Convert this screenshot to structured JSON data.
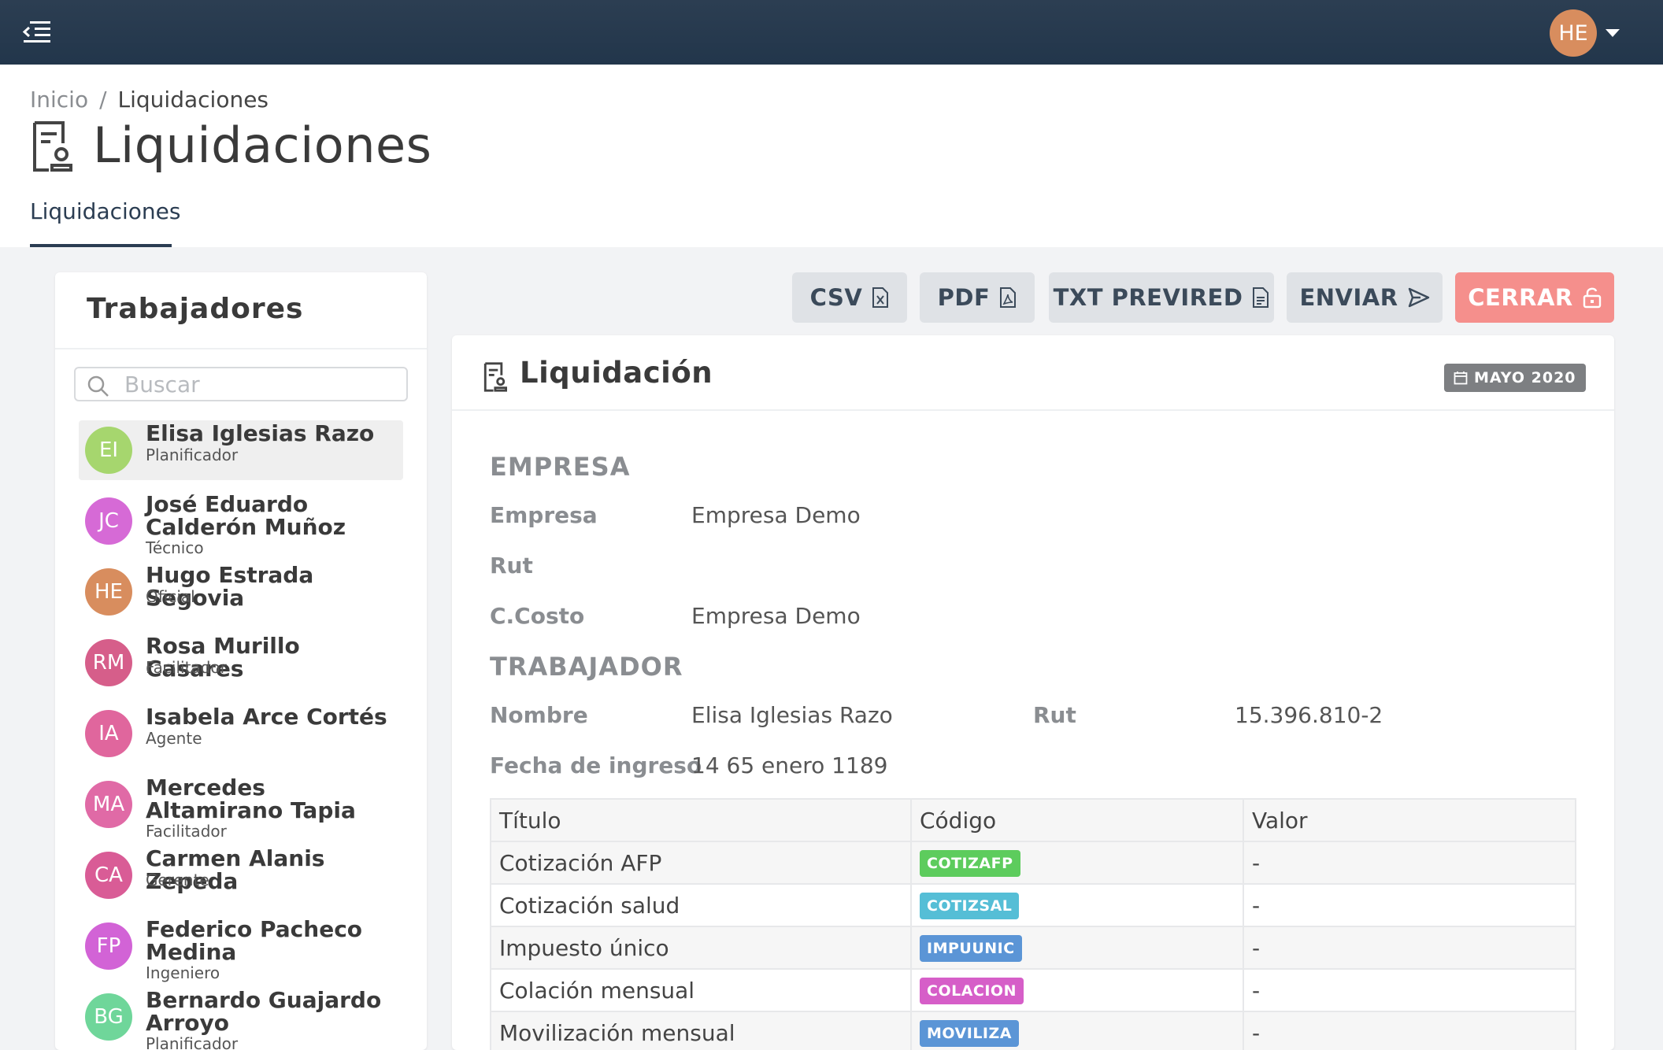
{
  "topbar": {
    "menu_icon": "menu-collapse-icon",
    "user_initials": "HE",
    "user_avatar_color": "#d88d5e"
  },
  "breadcrumb": {
    "home": "Inicio",
    "separator": "/",
    "current": "Liquidaciones"
  },
  "page": {
    "title": "Liquidaciones",
    "tab": "Liquidaciones"
  },
  "workers": {
    "title": "Trabajadores",
    "search_placeholder": "Buscar",
    "items": [
      {
        "initials": "EI",
        "name": "Elisa Iglesias Razo",
        "role": "Planificador",
        "color": "#a6d66e",
        "selected": true
      },
      {
        "initials": "JC",
        "name": "José Eduardo Calderón Muñoz",
        "role": "Técnico",
        "color": "#d66ad6"
      },
      {
        "initials": "HE",
        "name": "Hugo Estrada Segovia",
        "role": "Oficial",
        "color": "#d88d5e"
      },
      {
        "initials": "RM",
        "name": "Rosa Murillo Casares",
        "role": "Facilitador",
        "color": "#d65e8a"
      },
      {
        "initials": "IA",
        "name": "Isabela Arce Cortés",
        "role": "Agente",
        "color": "#e0669d"
      },
      {
        "initials": "MA",
        "name": "Mercedes Altamirano Tapia",
        "role": "Facilitador",
        "color": "#e06aa6"
      },
      {
        "initials": "CA",
        "name": "Carmen Alanis Zepeda",
        "role": "Gerente",
        "color": "#d95c96"
      },
      {
        "initials": "FP",
        "name": "Federico Pacheco Medina",
        "role": "Ingeniero",
        "color": "#d263d6"
      },
      {
        "initials": "BG",
        "name": "Bernardo Guajardo Arroyo",
        "role": "Planificador",
        "color": "#6fd69a"
      }
    ]
  },
  "actions": {
    "csv": "CSV",
    "pdf": "PDF",
    "txt": "TXT PREVIRED",
    "send": "ENVIAR",
    "close": "CERRAR",
    "close_color": "#f58f8c"
  },
  "liquidacion": {
    "title": "Liquidación",
    "period": "MAYO 2020",
    "empresa_section": "EMPRESA",
    "empresa_label": "Empresa",
    "empresa_value": "Empresa Demo",
    "rut_label": "Rut",
    "ccosto_label": "C.Costo",
    "ccosto_value": "Empresa Demo",
    "trabajador_section": "TRABAJADOR",
    "nombre_label": "Nombre",
    "nombre_value": "Elisa Iglesias Razo",
    "trab_rut_label": "Rut",
    "trab_rut_value": "15.396.810-2",
    "ingreso_label": "Fecha de ingreso",
    "ingreso_value": "14 65 enero 1189",
    "table": {
      "headers": [
        "Título",
        "Código",
        "Valor"
      ],
      "rows": [
        {
          "title": "Cotización AFP",
          "code": "COTIZAFP",
          "color": "#5dcc5d",
          "value": "-"
        },
        {
          "title": "Cotización salud",
          "code": "COTIZSAL",
          "color": "#55bed6",
          "value": "-"
        },
        {
          "title": "Impuesto único",
          "code": "IMPUUNIC",
          "color": "#5b95d6",
          "value": "-"
        },
        {
          "title": "Colación mensual",
          "code": "COLACION",
          "color": "#d65ec8",
          "value": "-"
        },
        {
          "title": "Movilización mensual",
          "code": "MOVILIZA",
          "color": "#5b95d6",
          "value": "-"
        }
      ]
    }
  }
}
